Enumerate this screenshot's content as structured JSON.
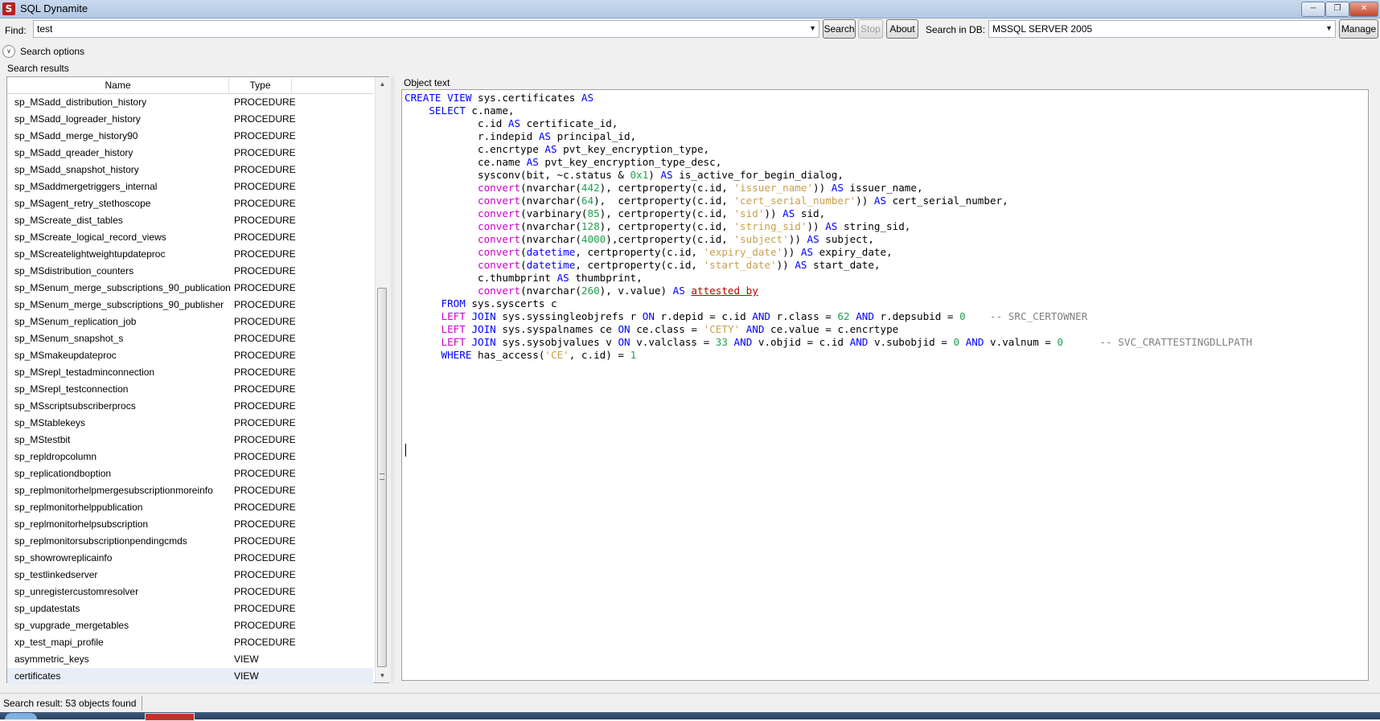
{
  "window": {
    "title": "SQL Dynamite",
    "icon": "app-logo-icon"
  },
  "toolbar": {
    "find_label": "Find:",
    "find_value": "test",
    "search_label": "Search",
    "stop_label": "Stop",
    "about_label": "About",
    "searchdb_label": "Search in DB:",
    "db_value": "MSSQL SERVER 2005",
    "manage_label": "Manage"
  },
  "search_options": {
    "label": "Search options"
  },
  "results": {
    "label": "Search results",
    "columns": {
      "name": "Name",
      "type": "Type"
    },
    "rows": [
      {
        "name": "sp_MSadd_distribution_history",
        "type": "PROCEDURE"
      },
      {
        "name": "sp_MSadd_logreader_history",
        "type": "PROCEDURE"
      },
      {
        "name": "sp_MSadd_merge_history90",
        "type": "PROCEDURE"
      },
      {
        "name": "sp_MSadd_qreader_history",
        "type": "PROCEDURE"
      },
      {
        "name": "sp_MSadd_snapshot_history",
        "type": "PROCEDURE"
      },
      {
        "name": "sp_MSaddmergetriggers_internal",
        "type": "PROCEDURE"
      },
      {
        "name": "sp_MSagent_retry_stethoscope",
        "type": "PROCEDURE"
      },
      {
        "name": "sp_MScreate_dist_tables",
        "type": "PROCEDURE"
      },
      {
        "name": "sp_MScreate_logical_record_views",
        "type": "PROCEDURE"
      },
      {
        "name": "sp_MScreatelightweightupdateproc",
        "type": "PROCEDURE"
      },
      {
        "name": "sp_MSdistribution_counters",
        "type": "PROCEDURE"
      },
      {
        "name": "sp_MSenum_merge_subscriptions_90_publication",
        "type": "PROCEDURE"
      },
      {
        "name": "sp_MSenum_merge_subscriptions_90_publisher",
        "type": "PROCEDURE"
      },
      {
        "name": "sp_MSenum_replication_job",
        "type": "PROCEDURE"
      },
      {
        "name": "sp_MSenum_snapshot_s",
        "type": "PROCEDURE"
      },
      {
        "name": "sp_MSmakeupdateproc",
        "type": "PROCEDURE"
      },
      {
        "name": "sp_MSrepl_testadminconnection",
        "type": "PROCEDURE"
      },
      {
        "name": "sp_MSrepl_testconnection",
        "type": "PROCEDURE"
      },
      {
        "name": "sp_MSscriptsubscriberprocs",
        "type": "PROCEDURE"
      },
      {
        "name": "sp_MStablekeys",
        "type": "PROCEDURE"
      },
      {
        "name": "sp_MStestbit",
        "type": "PROCEDURE"
      },
      {
        "name": "sp_repldropcolumn",
        "type": "PROCEDURE"
      },
      {
        "name": "sp_replicationdboption",
        "type": "PROCEDURE"
      },
      {
        "name": "sp_replmonitorhelpmergesubscriptionmoreinfo",
        "type": "PROCEDURE"
      },
      {
        "name": "sp_replmonitorhelppublication",
        "type": "PROCEDURE"
      },
      {
        "name": "sp_replmonitorhelpsubscription",
        "type": "PROCEDURE"
      },
      {
        "name": "sp_replmonitorsubscriptionpendingcmds",
        "type": "PROCEDURE"
      },
      {
        "name": "sp_showrowreplicainfo",
        "type": "PROCEDURE"
      },
      {
        "name": "sp_testlinkedserver",
        "type": "PROCEDURE"
      },
      {
        "name": "sp_unregistercustomresolver",
        "type": "PROCEDURE"
      },
      {
        "name": "sp_updatestats",
        "type": "PROCEDURE"
      },
      {
        "name": "sp_vupgrade_mergetables",
        "type": "PROCEDURE"
      },
      {
        "name": "xp_test_mapi_profile",
        "type": "PROCEDURE"
      },
      {
        "name": "asymmetric_keys",
        "type": "VIEW"
      },
      {
        "name": "certificates",
        "type": "VIEW"
      }
    ],
    "selected_row": "certificates"
  },
  "object_text": {
    "label": "Object text",
    "lines": [
      [
        [
          "k",
          "CREATE VIEW"
        ],
        [
          "t",
          " sys.certificates "
        ],
        [
          "k",
          "AS"
        ]
      ],
      [
        [
          "t",
          "    "
        ],
        [
          "k",
          "SELECT"
        ],
        [
          "t",
          " c.name,"
        ]
      ],
      [
        [
          "t",
          "            c.id "
        ],
        [
          "k",
          "AS"
        ],
        [
          "t",
          " certificate_id,"
        ]
      ],
      [
        [
          "t",
          "            r.indepid "
        ],
        [
          "k",
          "AS"
        ],
        [
          "t",
          " principal_id,"
        ]
      ],
      [
        [
          "t",
          "            c.encrtype "
        ],
        [
          "k",
          "AS"
        ],
        [
          "t",
          " pvt_key_encryption_type,"
        ]
      ],
      [
        [
          "t",
          "            ce.name "
        ],
        [
          "k",
          "AS"
        ],
        [
          "t",
          " pvt_key_encryption_type_desc,"
        ]
      ],
      [
        [
          "t",
          "            sysconv(bit, ~c.status & "
        ],
        [
          "n",
          "0x1"
        ],
        [
          "t",
          ") "
        ],
        [
          "k",
          "AS"
        ],
        [
          "t",
          " is_active_for_begin_dialog,"
        ]
      ],
      [
        [
          "t",
          "            "
        ],
        [
          "f",
          "convert"
        ],
        [
          "t",
          "(nvarchar("
        ],
        [
          "n",
          "442"
        ],
        [
          "t",
          "), certproperty(c.id, "
        ],
        [
          "s",
          "'issuer_name'"
        ],
        [
          "t",
          ")) "
        ],
        [
          "k",
          "AS"
        ],
        [
          "t",
          " issuer_name,"
        ]
      ],
      [
        [
          "t",
          "            "
        ],
        [
          "f",
          "convert"
        ],
        [
          "t",
          "(nvarchar("
        ],
        [
          "n",
          "64"
        ],
        [
          "t",
          "),  certproperty(c.id, "
        ],
        [
          "s",
          "'cert_serial_number'"
        ],
        [
          "t",
          ")) "
        ],
        [
          "k",
          "AS"
        ],
        [
          "t",
          " cert_serial_number,"
        ]
      ],
      [
        [
          "t",
          "            "
        ],
        [
          "f",
          "convert"
        ],
        [
          "t",
          "(varbinary("
        ],
        [
          "n",
          "85"
        ],
        [
          "t",
          "), certproperty(c.id, "
        ],
        [
          "s",
          "'sid'"
        ],
        [
          "t",
          ")) "
        ],
        [
          "k",
          "AS"
        ],
        [
          "t",
          " sid,"
        ]
      ],
      [
        [
          "t",
          "            "
        ],
        [
          "f",
          "convert"
        ],
        [
          "t",
          "(nvarchar("
        ],
        [
          "n",
          "128"
        ],
        [
          "t",
          "), certproperty(c.id, "
        ],
        [
          "s",
          "'string_sid'"
        ],
        [
          "t",
          ")) "
        ],
        [
          "k",
          "AS"
        ],
        [
          "t",
          " string_sid,"
        ]
      ],
      [
        [
          "t",
          "            "
        ],
        [
          "f",
          "convert"
        ],
        [
          "t",
          "(nvarchar("
        ],
        [
          "n",
          "4000"
        ],
        [
          "t",
          "),certproperty(c.id, "
        ],
        [
          "s",
          "'subject'"
        ],
        [
          "t",
          ")) "
        ],
        [
          "k",
          "AS"
        ],
        [
          "t",
          " subject,"
        ]
      ],
      [
        [
          "t",
          "            "
        ],
        [
          "f",
          "convert"
        ],
        [
          "t",
          "("
        ],
        [
          "k",
          "datetime"
        ],
        [
          "t",
          ", certproperty(c.id, "
        ],
        [
          "s",
          "'expiry_date'"
        ],
        [
          "t",
          ")) "
        ],
        [
          "k",
          "AS"
        ],
        [
          "t",
          " expiry_date,"
        ]
      ],
      [
        [
          "t",
          "            "
        ],
        [
          "f",
          "convert"
        ],
        [
          "t",
          "("
        ],
        [
          "k",
          "datetime"
        ],
        [
          "t",
          ", certproperty(c.id, "
        ],
        [
          "s",
          "'start_date'"
        ],
        [
          "t",
          ")) "
        ],
        [
          "k",
          "AS"
        ],
        [
          "t",
          " start_date,"
        ]
      ],
      [
        [
          "t",
          "            c.thumbprint "
        ],
        [
          "k",
          "AS"
        ],
        [
          "t",
          " thumbprint,"
        ]
      ],
      [
        [
          "t",
          "            "
        ],
        [
          "f",
          "convert"
        ],
        [
          "t",
          "(nvarchar("
        ],
        [
          "n",
          "260"
        ],
        [
          "t",
          "), v.value) "
        ],
        [
          "k",
          "AS"
        ],
        [
          "t",
          " "
        ],
        [
          "u",
          "attested by"
        ]
      ],
      [
        [
          "t",
          "      "
        ],
        [
          "k",
          "FROM"
        ],
        [
          "t",
          " sys.syscerts c"
        ]
      ],
      [
        [
          "t",
          "      "
        ],
        [
          "f",
          "LEFT"
        ],
        [
          "t",
          " "
        ],
        [
          "k",
          "JOIN"
        ],
        [
          "t",
          " sys.syssingleobjrefs r "
        ],
        [
          "k",
          "ON"
        ],
        [
          "t",
          " r.depid = c.id "
        ],
        [
          "k",
          "AND"
        ],
        [
          "t",
          " r.class = "
        ],
        [
          "n",
          "62"
        ],
        [
          "t",
          " "
        ],
        [
          "k",
          "AND"
        ],
        [
          "t",
          " r.depsubid = "
        ],
        [
          "n",
          "0"
        ],
        [
          "t",
          "    "
        ],
        [
          "c",
          "-- SRC_CERTOWNER"
        ]
      ],
      [
        [
          "t",
          "      "
        ],
        [
          "f",
          "LEFT"
        ],
        [
          "t",
          " "
        ],
        [
          "k",
          "JOIN"
        ],
        [
          "t",
          " sys.syspalnames ce "
        ],
        [
          "k",
          "ON"
        ],
        [
          "t",
          " ce.class = "
        ],
        [
          "s",
          "'CETY'"
        ],
        [
          "t",
          " "
        ],
        [
          "k",
          "AND"
        ],
        [
          "t",
          " ce.value = c.encrtype"
        ]
      ],
      [
        [
          "t",
          "      "
        ],
        [
          "f",
          "LEFT"
        ],
        [
          "t",
          " "
        ],
        [
          "k",
          "JOIN"
        ],
        [
          "t",
          " sys.sysobjvalues v "
        ],
        [
          "k",
          "ON"
        ],
        [
          "t",
          " v.valclass = "
        ],
        [
          "n",
          "33"
        ],
        [
          "t",
          " "
        ],
        [
          "k",
          "AND"
        ],
        [
          "t",
          " v.objid = c.id "
        ],
        [
          "k",
          "AND"
        ],
        [
          "t",
          " v.subobjid = "
        ],
        [
          "n",
          "0"
        ],
        [
          "t",
          " "
        ],
        [
          "k",
          "AND"
        ],
        [
          "t",
          " v.valnum = "
        ],
        [
          "n",
          "0"
        ],
        [
          "t",
          "      "
        ],
        [
          "c",
          "-- SVC_CRATTESTINGDLLPATH"
        ]
      ],
      [
        [
          "t",
          "      "
        ],
        [
          "k",
          "WHERE"
        ],
        [
          "t",
          " has_access("
        ],
        [
          "s",
          "'CE'"
        ],
        [
          "t",
          ", c.id) = "
        ],
        [
          "n",
          "1"
        ]
      ]
    ]
  },
  "status": {
    "label": "Search result:  53 objects found"
  }
}
